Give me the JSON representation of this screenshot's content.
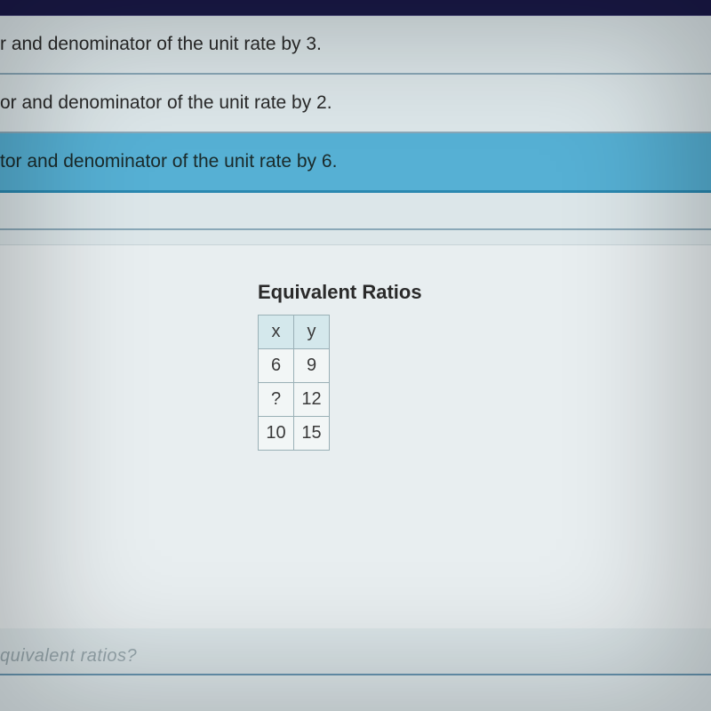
{
  "options": [
    "r and denominator of the unit rate by 3.",
    "or and denominator of the unit rate by 2.",
    "tor and denominator of the unit rate by 6."
  ],
  "table": {
    "title": "Equivalent Ratios",
    "headers": {
      "x": "x",
      "y": "y"
    },
    "rows": [
      {
        "x": "6",
        "y": "9"
      },
      {
        "x": "?",
        "y": "12"
      },
      {
        "x": "10",
        "y": "15"
      }
    ]
  },
  "footer_question": "quivalent ratios?",
  "chart_data": {
    "type": "table",
    "title": "Equivalent Ratios",
    "columns": [
      "x",
      "y"
    ],
    "rows": [
      [
        6,
        9
      ],
      [
        null,
        12
      ],
      [
        10,
        15
      ]
    ],
    "note": "null represents unknown value shown as '?'"
  }
}
